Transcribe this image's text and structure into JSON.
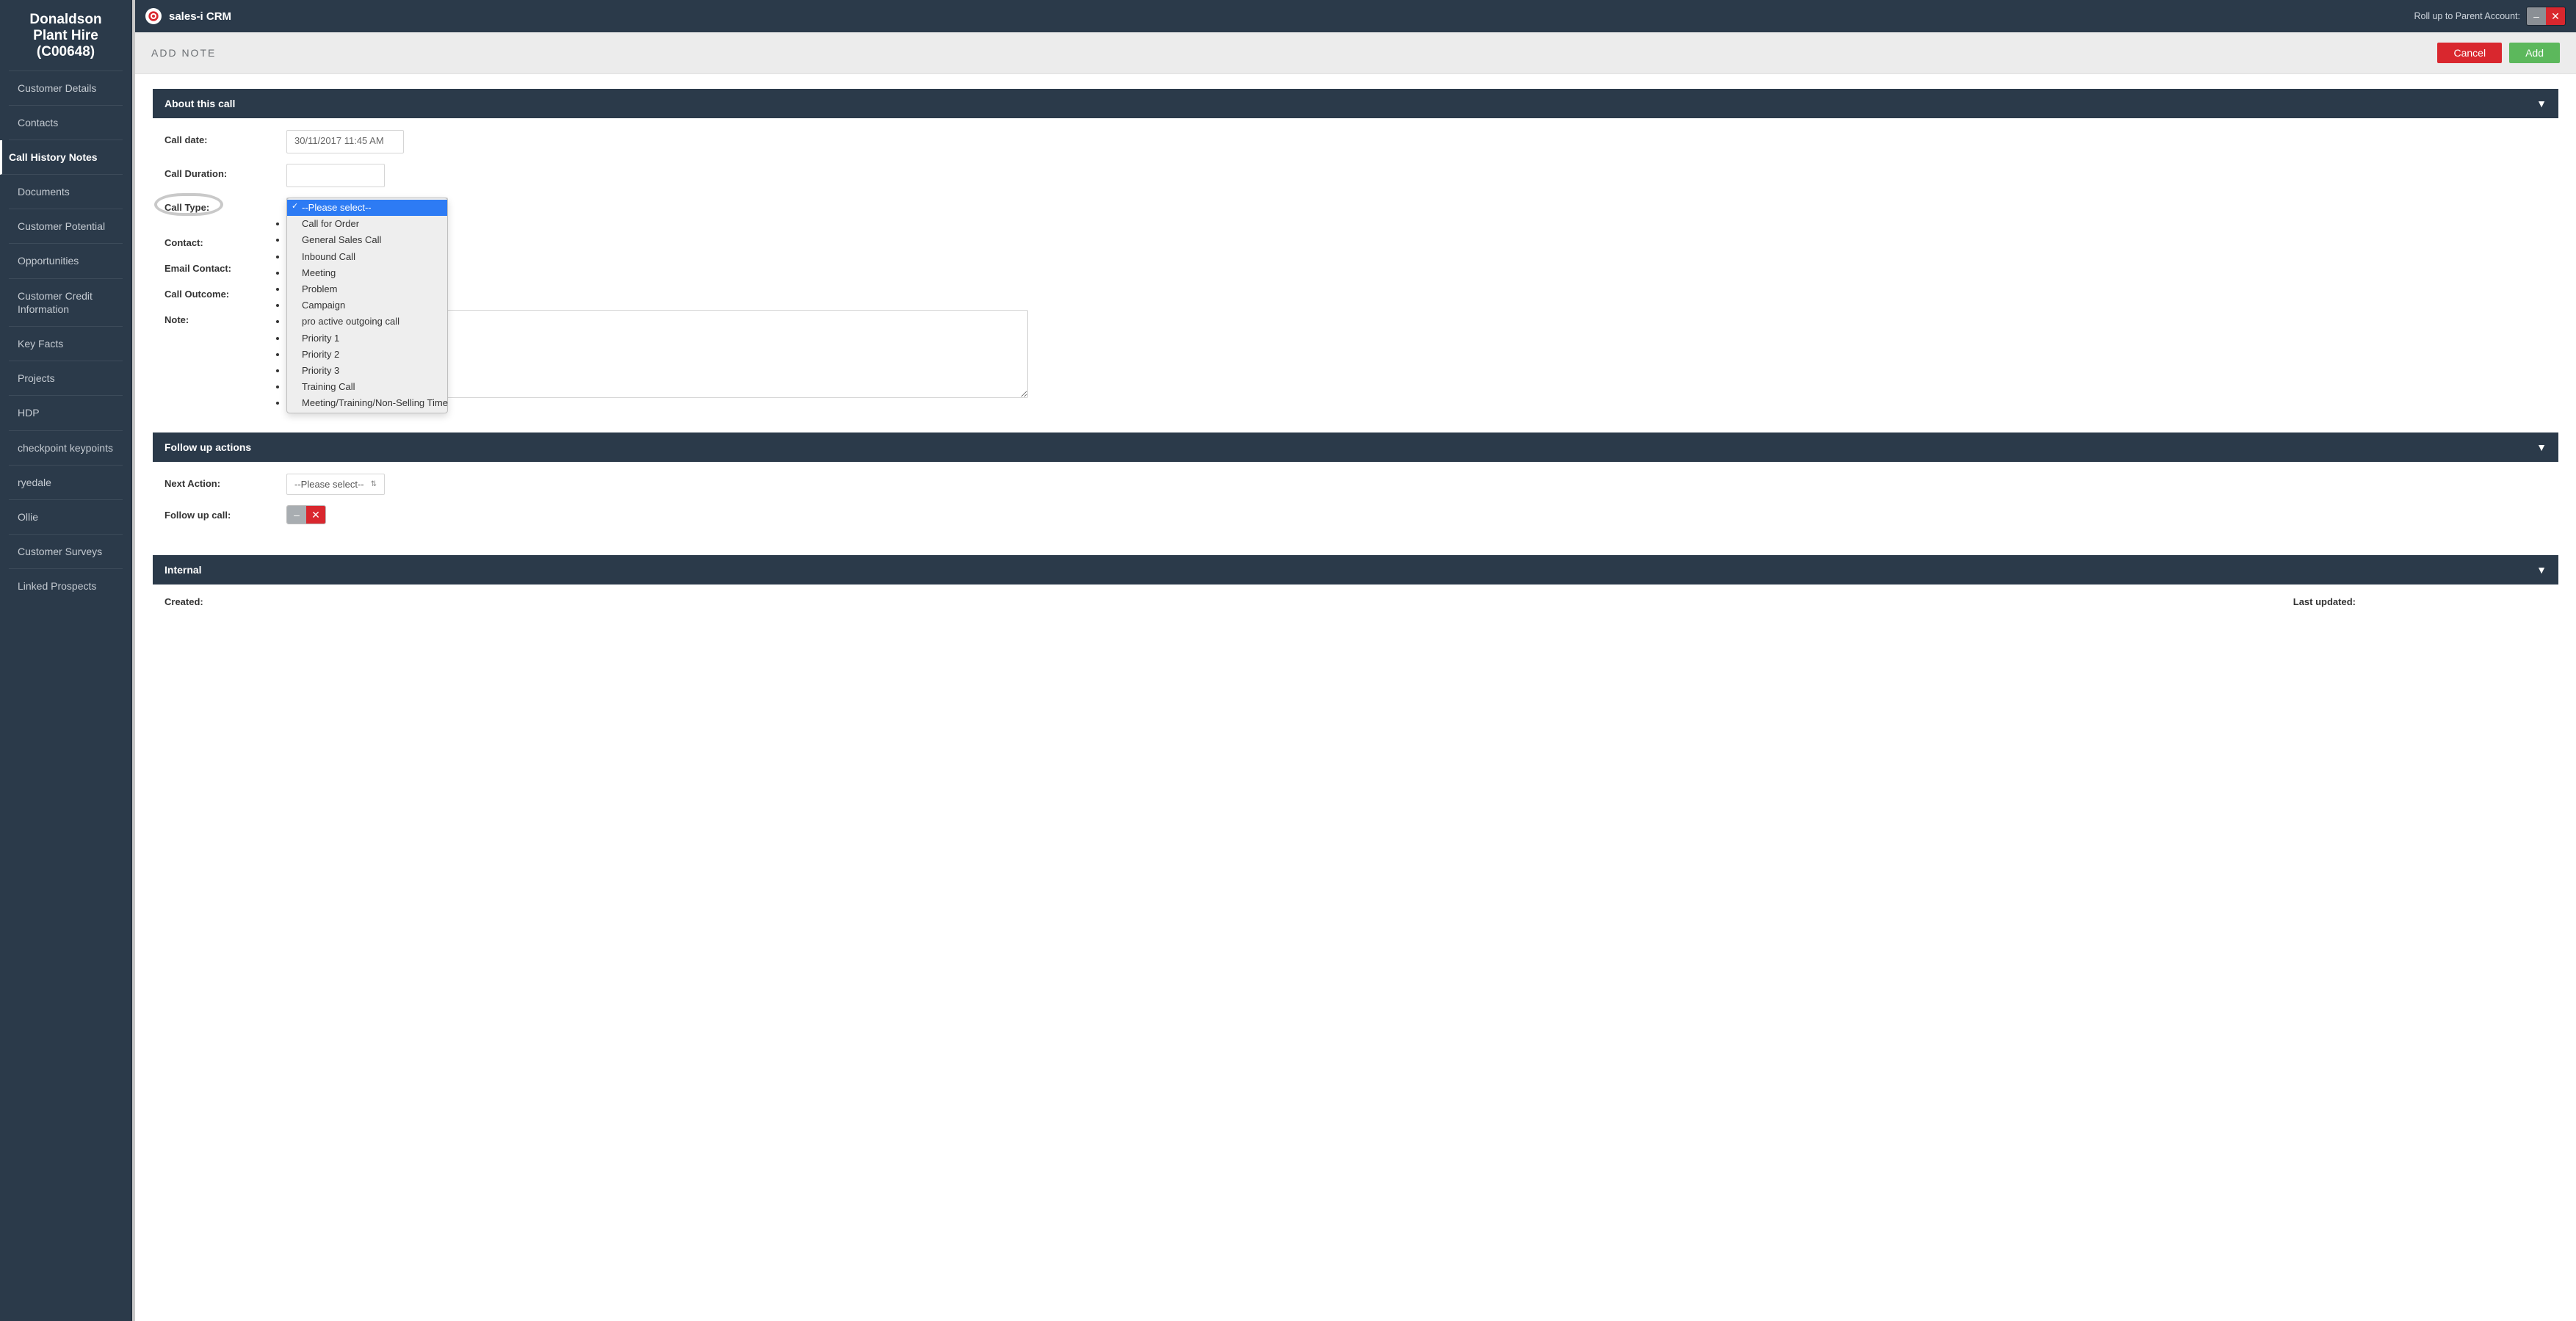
{
  "sidebar": {
    "title_line1": "Donaldson",
    "title_line2": "Plant Hire",
    "title_line3": "(C00648)",
    "items": [
      {
        "label": "Customer Details"
      },
      {
        "label": "Contacts"
      },
      {
        "label": "Call History Notes"
      },
      {
        "label": "Documents"
      },
      {
        "label": "Customer Potential"
      },
      {
        "label": "Opportunities"
      },
      {
        "label": "Customer Credit Information"
      },
      {
        "label": "Key Facts"
      },
      {
        "label": "Projects"
      },
      {
        "label": "HDP"
      },
      {
        "label": "checkpoint keypoints"
      },
      {
        "label": "ryedale"
      },
      {
        "label": "Ollie"
      },
      {
        "label": "Customer Surveys"
      },
      {
        "label": "Linked Prospects"
      }
    ],
    "active_index": 2
  },
  "topbar": {
    "brand": "sales-i CRM",
    "rollup_label": "Roll up to Parent Account:"
  },
  "subbar": {
    "title": "ADD NOTE",
    "cancel": "Cancel",
    "add": "Add"
  },
  "about": {
    "header": "About this call",
    "call_date_label": "Call date:",
    "call_date_value": "30/11/2017 11:45 AM",
    "call_duration_label": "Call Duration:",
    "call_type_label": "Call Type:",
    "contact_label": "Contact:",
    "email_contact_label": "Email Contact:",
    "call_outcome_label": "Call Outcome:",
    "note_label": "Note:",
    "call_type_options": [
      "--Please select--",
      "Call for Order",
      "General Sales Call",
      "Inbound Call",
      "Meeting",
      "Problem",
      "Campaign",
      "pro active outgoing call",
      "Priority 1",
      "Priority 2",
      "Priority 3",
      "Training Call",
      "Meeting/Training/Non-Selling Time"
    ],
    "call_type_selected_index": 0
  },
  "followup": {
    "header": "Follow up actions",
    "next_action_label": "Next Action:",
    "next_action_value": "--Please select--",
    "follow_up_call_label": "Follow up call:"
  },
  "internal": {
    "header": "Internal",
    "created_label": "Created:",
    "last_updated_label": "Last updated:"
  }
}
